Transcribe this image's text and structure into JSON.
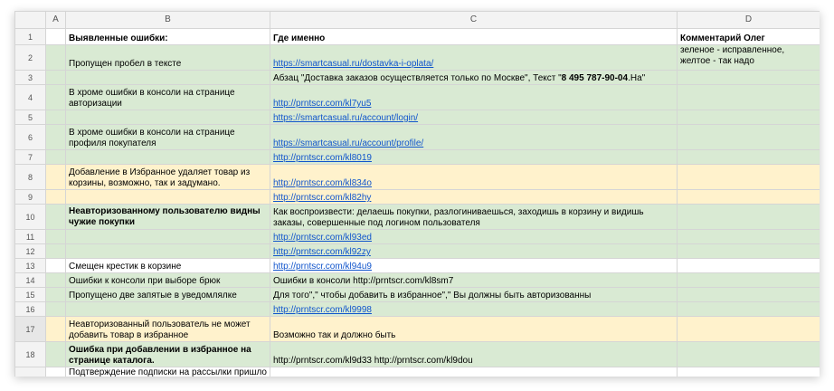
{
  "columns": [
    "",
    "A",
    "B",
    "C",
    "D"
  ],
  "header_row": {
    "num": "1",
    "b": "Выявленные ошибки:",
    "c": "Где именно",
    "d": "Комментарий Олег"
  },
  "rows": [
    {
      "num": "2",
      "b": "Пропущен пробел в тексте",
      "c": "https://smartcasual.ru/dostavka-i-oplata/",
      "c_link": true,
      "d": "зеленое - исправленное, желтое - так надо"
    },
    {
      "num": "3",
      "b": "",
      "c": "Абзац \"Доставка заказов осуществляется только по Москве\", Текст \"",
      "c_bold": "8 495 787-90-04",
      "c_tail": ".На\"",
      "d": ""
    },
    {
      "num": "4",
      "b": "В хроме  ошибки в консоли на странице авторизации",
      "c": "http://prntscr.com/kl7yu5 ",
      "c_link": true,
      "d": ""
    },
    {
      "num": "5",
      "b": "",
      "c": "https://smartcasual.ru/account/login/",
      "c_link": true,
      "d": ""
    },
    {
      "num": "6",
      "b": "В хроме ошибки в консоли на странице профиля покупателя",
      "c": "https://smartcasual.ru/account/profile/",
      "c_link": true,
      "d": ""
    },
    {
      "num": "7",
      "b": "",
      "c": "http://prntscr.com/kl8019",
      "c_link": true,
      "d": ""
    },
    {
      "num": "8",
      "b": "Добавление в Избранное удаляет товар из корзины, возможно, так и задумано.",
      "c": "http://prntscr.com/kl834o ",
      "c_link": true,
      "d": ""
    },
    {
      "num": "9",
      "b": "",
      "c": "http://prntscr.com/kl82hy",
      "c_link": true,
      "d": ""
    },
    {
      "num": "10",
      "b": "Неавторизованному пользователю видны чужие покупки",
      "b_bold": true,
      "c": "Как воспроизвести: делаешь покупки, разлогиниваешься, заходишь в корзину и видишь заказы, совершенные под логином пользователя",
      "d": ""
    },
    {
      "num": "11",
      "b": "",
      "c": "http://prntscr.com/kl93ed",
      "c_link": true,
      "d": ""
    },
    {
      "num": "12",
      "b": "",
      "c": "http://prntscr.com/kl92zy",
      "c_link": true,
      "d": ""
    },
    {
      "num": "13",
      "b": "Смещен крестик в корзине",
      "c": "http://prntscr.com/kl94u9",
      "c_link": true,
      "d": ""
    },
    {
      "num": "14",
      "b": "Ошибки к консоли при выборе брюк",
      "c": "Ошибки в консоли http://prntscr.com/kl8sm7",
      "d": ""
    },
    {
      "num": "15",
      "b": "Пропущено две запятые в уведомлялке",
      "c": "Для того\",\" чтобы добавить в избранное\",\" Вы должны быть авторизованны",
      "d": ""
    },
    {
      "num": "16",
      "b": "",
      "c": "http://prntscr.com/kl9998",
      "c_link": true,
      "d": ""
    },
    {
      "num": "17",
      "b": "Неавторизованный пользователь не может добавить товар в избранное",
      "c": "Возможно так и должно быть",
      "d": ""
    },
    {
      "num": "18",
      "b": "Ошибка при добавлении в избранное на странице каталога.",
      "b_bold": true,
      "c": "http://prntscr.com/kl9d33 http://prntscr.com/kl9dou",
      "d": ""
    },
    {
      "num": "19",
      "b": "Подтверждение подписки на рассылки пришло в папку спам в gmail, подписывался в хроме",
      "c": "",
      "d": ""
    }
  ],
  "colors": {
    "green": "#d9ead3",
    "yellow": "#fff2cc",
    "link": "#1155cc",
    "header_bg": "#f3f3f3"
  }
}
